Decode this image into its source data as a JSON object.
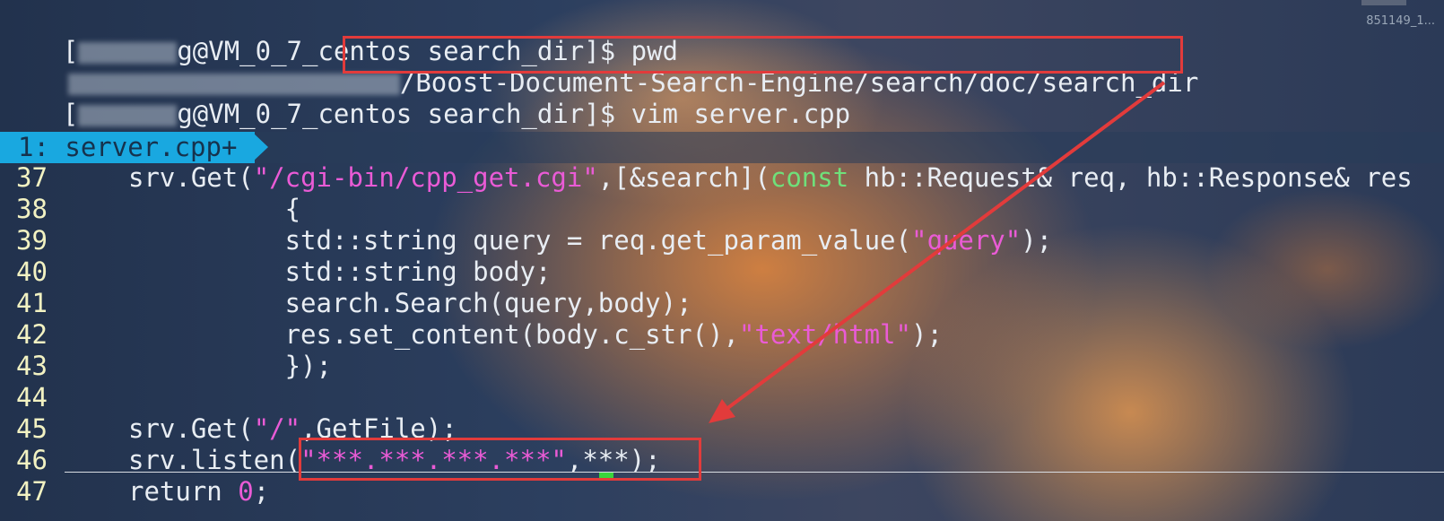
{
  "terminal": {
    "line1_prompt_suffix": "g@VM_0_7_centos search_dir]$ pwd",
    "line2_path": "Boost-Document-Search-Engine/search/doc/search_dir",
    "line3_prompt_suffix": "g@VM_0_7_centos search_dir]$ vim server.cpp",
    "prompt_open": "[",
    "slash": "/",
    "corner_label": "851149_1..."
  },
  "vim": {
    "tab_label": "1: server.cpp+",
    "lines": [
      {
        "num": "37",
        "parts": [
          [
            "srv.Get(",
            "n"
          ],
          [
            "\"/cgi-bin/cpp_get.cgi\"",
            "s"
          ],
          [
            ",[&search](",
            "n"
          ],
          [
            "const",
            "k"
          ],
          [
            " hb::Request& req, hb::Response& res",
            "n"
          ]
        ]
      },
      {
        "num": "38",
        "parts": [
          [
            "          {",
            "n"
          ]
        ]
      },
      {
        "num": "39",
        "parts": [
          [
            "          std::string query = req.get_param_value(",
            "n"
          ],
          [
            "\"query\"",
            "s"
          ],
          [
            ");",
            "n"
          ]
        ]
      },
      {
        "num": "40",
        "parts": [
          [
            "          std::string body;",
            "n"
          ]
        ]
      },
      {
        "num": "41",
        "parts": [
          [
            "          search.Search(query,body);",
            "n"
          ]
        ]
      },
      {
        "num": "42",
        "parts": [
          [
            "          res.set_content(body.c_str(),",
            "n"
          ],
          [
            "\"text/html\"",
            "s"
          ],
          [
            ");",
            "n"
          ]
        ]
      },
      {
        "num": "43",
        "parts": [
          [
            "          });",
            "n"
          ]
        ]
      },
      {
        "num": "44",
        "parts": []
      },
      {
        "num": "45",
        "parts": [
          [
            "srv.Get(",
            "n"
          ],
          [
            "\"/\"",
            "s"
          ],
          [
            ",GetFile);",
            "n"
          ]
        ]
      },
      {
        "num": "46",
        "parts": [
          [
            "srv.listen(",
            "n"
          ],
          [
            "\"***.***.***.***\"",
            "s"
          ],
          [
            ",***);",
            "n"
          ]
        ]
      },
      {
        "num": "47",
        "parts": [
          [
            "return ",
            "n"
          ],
          [
            "0",
            "s"
          ],
          [
            ";",
            "n"
          ]
        ]
      }
    ]
  },
  "colors": {
    "highlight_box": "#e23b3b",
    "tab_bg": "#19a8e0",
    "string": "#ea5bd6",
    "keyword": "#6fe07a",
    "line_number": "#f2f2c2",
    "cursor": "#39d43c"
  }
}
